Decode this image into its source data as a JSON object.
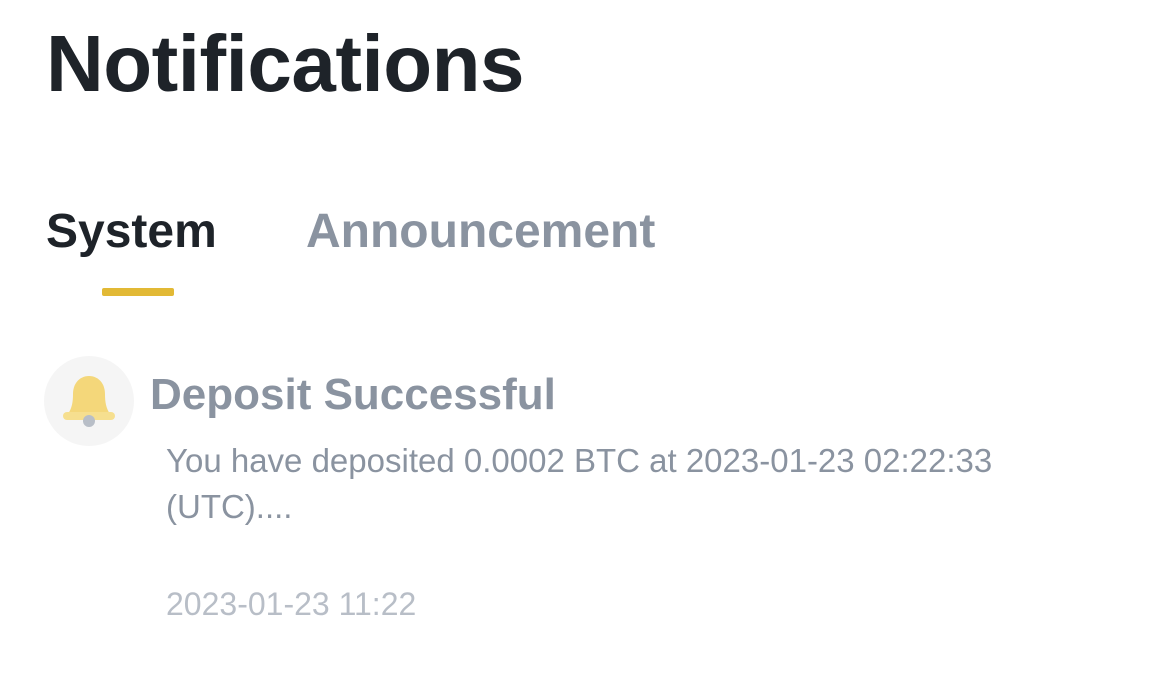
{
  "header": {
    "title": "Notifications"
  },
  "tabs": [
    {
      "label": "System",
      "active": true
    },
    {
      "label": "Announcement",
      "active": false
    }
  ],
  "colors": {
    "accent": "#e2b935",
    "title_text": "#1e2329",
    "muted_text": "#8a93a0",
    "time_text": "#b8bec7",
    "bell": "#f4d77a"
  },
  "notifications": [
    {
      "icon": "bell-icon",
      "title": "Deposit Successful",
      "body": "You have deposited 0.0002 BTC at 2023-01-23 02:22:33 (UTC)....",
      "time": "2023-01-23 11:22"
    }
  ]
}
